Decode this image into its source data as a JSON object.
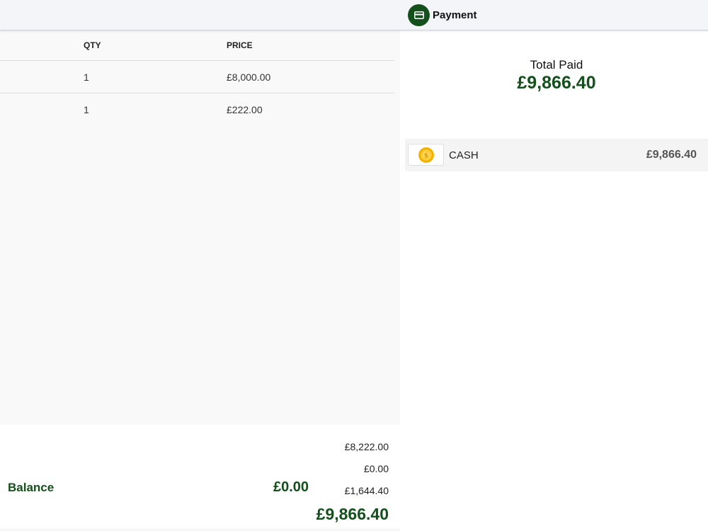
{
  "header": {
    "payment_title": "Payment",
    "payment_icon": "card-icon",
    "accent_color": "#14501b"
  },
  "items_table": {
    "columns": [
      "QTY",
      "PRICE"
    ],
    "rows": [
      {
        "qty": "1",
        "price": "£8,000.00"
      },
      {
        "qty": "1",
        "price": "£222.00"
      }
    ]
  },
  "summary": {
    "subtotal": "£8,222.00",
    "discount": "£0.00",
    "tax": "£1,644.40",
    "total": "£9,866.40"
  },
  "payment_panel": {
    "total_paid_label": "Total Paid",
    "total_paid_amount": "£9,866.40",
    "methods": [
      {
        "icon": "coin-icon",
        "label": "CASH",
        "amount": "£9,866.40"
      }
    ],
    "balance_label": "Balance",
    "balance_amount": "£0.00"
  }
}
